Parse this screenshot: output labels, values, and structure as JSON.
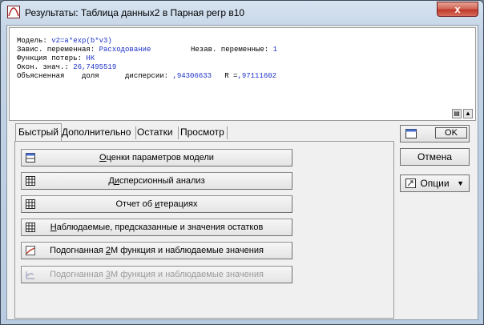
{
  "window": {
    "title": "Результаты: Таблица данных2 в Парная регр в10",
    "close_label": "x"
  },
  "results": {
    "model_label": "Модель:",
    "model_value": "v2=a*exp(b*v3)",
    "dep_label": "Завис. переменная:",
    "dep_value": "Расходование",
    "indep_label": "Незав. переменные:",
    "indep_value": "1",
    "loss_label": "Функция потерь:",
    "loss_value": "НК",
    "final_label": "Окон. знач.:",
    "final_value": "26,7495519",
    "explained_label": "Объясненная    доля      дисперсии:",
    "explained_value": ",94306633",
    "r_label": "R =",
    "r_value": ",97111602"
  },
  "tabs": [
    "Быстрый",
    "Дополнительно",
    "Остатки",
    "Просмотр"
  ],
  "buttons": {
    "params": {
      "pre": "",
      "ul": "О",
      "post": "ценки параметров модели"
    },
    "anova": {
      "pre": "Д",
      "ul": "и",
      "post": "сперсионный анализ"
    },
    "iter": {
      "pre": "Отчет об ",
      "ul": "и",
      "post": "терациях"
    },
    "obs": {
      "pre": "",
      "ul": "Н",
      "post": "аблюдаемые, предсказанные и значения остатков"
    },
    "fit2d": {
      "pre": "Подогнанная ",
      "ul": "2",
      "post": "М функция и наблюдаемые значения"
    },
    "fit3d": {
      "pre": "Подогнанная ",
      "ul": "3",
      "post": "М функция и наблюдаемые значения"
    }
  },
  "side": {
    "ok": "OK",
    "cancel": "Отмена",
    "options": "Опции"
  }
}
